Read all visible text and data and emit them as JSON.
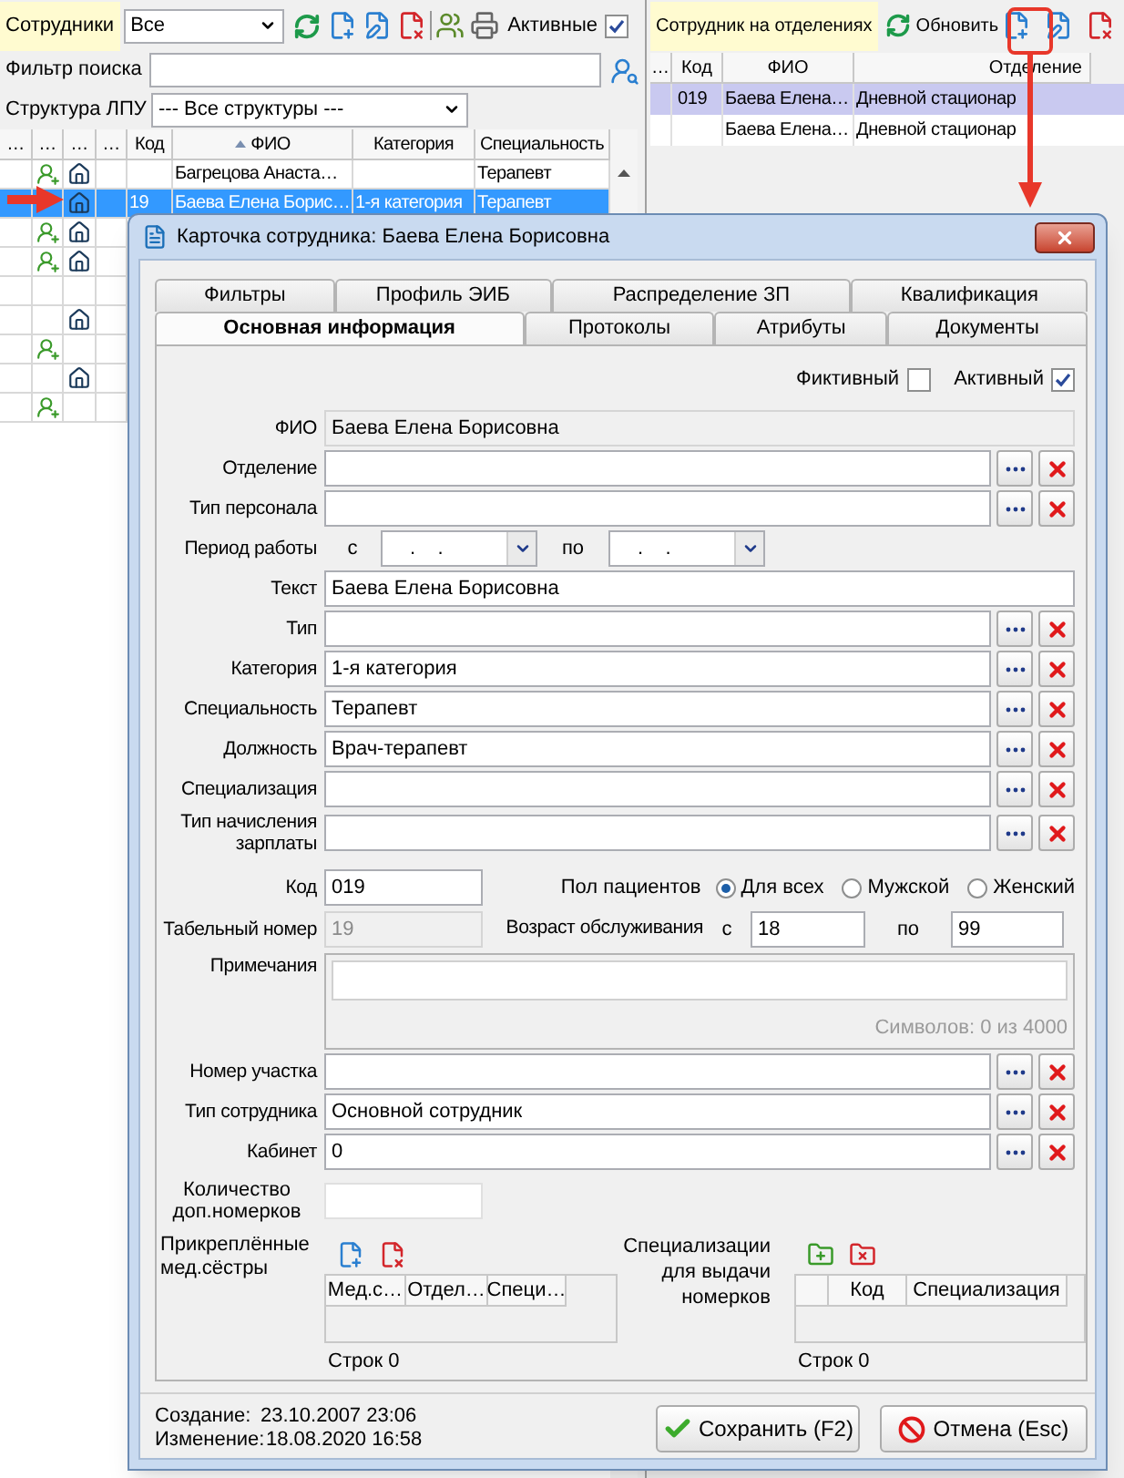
{
  "employees": {
    "title": "Сотрудники",
    "filter": "Все",
    "active": {
      "label": "Активные",
      "checked": true
    },
    "search_label": "Фильтр поиска",
    "structure_label": "Структура ЛПУ",
    "structure": "--- Все структуры ---",
    "columns": [
      {
        "label": "…",
        "sorted": false
      },
      {
        "label": "…",
        "sorted": false
      },
      {
        "label": "…",
        "sorted": false
      },
      {
        "label": "…",
        "sorted": false
      },
      {
        "label": "Код",
        "sorted": false
      },
      {
        "label": "ФИО",
        "sorted": true
      },
      {
        "label": "Категория",
        "sorted": false
      },
      {
        "label": "Специальность",
        "sorted": false
      }
    ],
    "rows": [
      {
        "person": true,
        "house": true,
        "name": "Багрецова Анаста…",
        "specialty": "Терапевт",
        "selected": false
      },
      {
        "person": false,
        "house": true,
        "code": "19",
        "name": "Баева Елена Борис…",
        "category": "1-я категория",
        "specialty": "Терапевт",
        "selected": true
      },
      {
        "person": true,
        "house": true,
        "selected": false
      },
      {
        "person": true,
        "house": true,
        "selected": false
      },
      {
        "person": false,
        "house": false,
        "selected": false
      },
      {
        "person": false,
        "house": true,
        "selected": false
      },
      {
        "person": true,
        "house": false,
        "selected": false
      },
      {
        "person": false,
        "house": true,
        "selected": false
      },
      {
        "person": true,
        "house": false,
        "selected": false
      }
    ]
  },
  "departments": {
    "title": "Сотрудник на отделениях",
    "refresh": "Обновить",
    "columns": [
      "…",
      "Код",
      "ФИО",
      "Отделение"
    ],
    "rows": [
      {
        "code": "019",
        "name": "Баева Елена…",
        "department": "Дневной стационар",
        "selected": true
      },
      {
        "name": "Баева Елена…",
        "department": "Дневной стационар",
        "selected": false
      }
    ]
  },
  "dialog": {
    "title": "Карточка сотрудника: Баева Елена Борисовна",
    "tab_rows": [
      [
        {
          "label": "Фильтры",
          "selected": false
        },
        {
          "label": "Профиль ЭИБ",
          "selected": false
        },
        {
          "label": "Распределение ЗП",
          "selected": false
        },
        {
          "label": "Квалификация",
          "selected": false
        }
      ],
      [
        {
          "label": "Основная информация",
          "selected": true
        },
        {
          "label": "Протоколы",
          "selected": false
        },
        {
          "label": "Атрибуты",
          "selected": false
        },
        {
          "label": "Документы",
          "selected": false
        }
      ]
    ],
    "flags": [
      {
        "label": "Фиктивный",
        "checked": false
      },
      {
        "label": "Активный",
        "checked": true
      }
    ],
    "fields": [
      {
        "kind": "readonly",
        "label": "ФИО",
        "value": "Баева Елена Борисовна"
      },
      {
        "kind": "lookup",
        "label": "Отделение"
      },
      {
        "kind": "lookup",
        "label": "Тип персонала"
      },
      {
        "kind": "period",
        "label": "Период работы",
        "from_label": "с",
        "from_value": ".    .",
        "to_label": "по",
        "to_value": ".    ."
      },
      {
        "kind": "text",
        "label": "Текст",
        "value": "Баева Елена Борисовна"
      },
      {
        "kind": "lookup",
        "label": "Тип"
      },
      {
        "kind": "lookup",
        "label": "Категория",
        "value": "1-я категория"
      },
      {
        "kind": "lookup",
        "label": "Специальность",
        "value": "Терапевт"
      },
      {
        "kind": "lookup",
        "label": "Должность",
        "value": "Врач-терапевт"
      },
      {
        "kind": "lookup",
        "label": "Специализация"
      },
      {
        "kind": "lookup",
        "label": "Тип начисления зарплаты"
      }
    ],
    "code": {
      "label": "Код",
      "value": "019"
    },
    "patient_sex": {
      "label": "Пол пациентов",
      "options": [
        {
          "label": "Для всех",
          "selected": true
        },
        {
          "label": "Мужской",
          "selected": false
        },
        {
          "label": "Женский",
          "selected": false
        }
      ]
    },
    "tab_number": {
      "label": "Табельный номер",
      "value": "19",
      "disabled": true
    },
    "age": {
      "label": "Возраст обслуживания",
      "from_label": "с",
      "from": "18",
      "to_label": "по",
      "to": "99"
    },
    "notes": {
      "label": "Примечания",
      "counter": "Символов: 0 из 4000"
    },
    "fields_2": [
      {
        "kind": "lookup",
        "label": "Номер участка"
      },
      {
        "kind": "lookup",
        "label": "Тип сотрудника",
        "value": "Основной сотрудник"
      },
      {
        "kind": "lookup",
        "label": "Кабинет",
        "value": "0"
      }
    ],
    "extra_count": {
      "label": "Количество доп.номерков"
    },
    "nurses": {
      "label": "Прикреплённые мед.сёстры",
      "columns": [
        "Мед.с…",
        "Отдел…",
        "Специ…"
      ],
      "footer": "Строк 0"
    },
    "specializations": {
      "label": "Специализации для выдачи номерков",
      "columns": [
        "Код",
        "Специализация"
      ],
      "footer": "Строк 0"
    },
    "created": {
      "label": "Создание:",
      "value": "23.10.2007 23:06"
    },
    "modified": {
      "label": "Изменение:",
      "value": "18.08.2020 16:58"
    },
    "buttons": [
      {
        "kind": "save",
        "label": "Сохранить (F2)"
      },
      {
        "kind": "cancel",
        "label": "Отмена (Esc)"
      }
    ]
  }
}
